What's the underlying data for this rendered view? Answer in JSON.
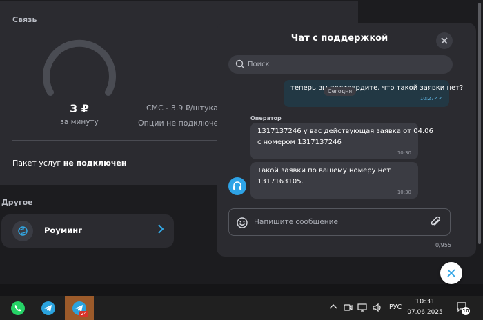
{
  "connection": {
    "title": "Связь",
    "price": "3 ₽",
    "price_unit": "за минуту",
    "sms": "СМС - 3.9 ₽/штука",
    "options": "Опции не подключены",
    "packet_prefix": "Пакет услуг",
    "packet_status": "не подключен",
    "gauge_level": 0.0
  },
  "other": {
    "title": "Другое",
    "roaming_label": "Роуминг"
  },
  "chat": {
    "title": "Чат с поддержкой",
    "search_placeholder": "Поиск",
    "today_badge": "Сегодня",
    "outgoing": {
      "text": "теперь вы подтвердите, что такой заявки нет?",
      "time": "10:27"
    },
    "operator_label": "Оператор",
    "incoming": [
      {
        "line1": "1317137246 у вас действующая заявка от 04.06",
        "line2": "с номером 1317137246",
        "time": "10:30"
      },
      {
        "line1": "Такой заявки по вашему номеру нет",
        "line2": "1317163105.",
        "time": "10:30"
      }
    ],
    "input_placeholder": "Напишите сообщение",
    "counter": "0/955"
  },
  "taskbar": {
    "apps": [
      "whatsapp-icon",
      "telegram-icon",
      "telegram-icon"
    ],
    "telegram_badge": "24",
    "lang": "РУС",
    "time": "10:31",
    "date": "07.06.2025",
    "notifications": "10"
  },
  "colors": {
    "accent": "#2ea3e6",
    "panel": "#2b2b30",
    "background": "#1c1c1f"
  }
}
